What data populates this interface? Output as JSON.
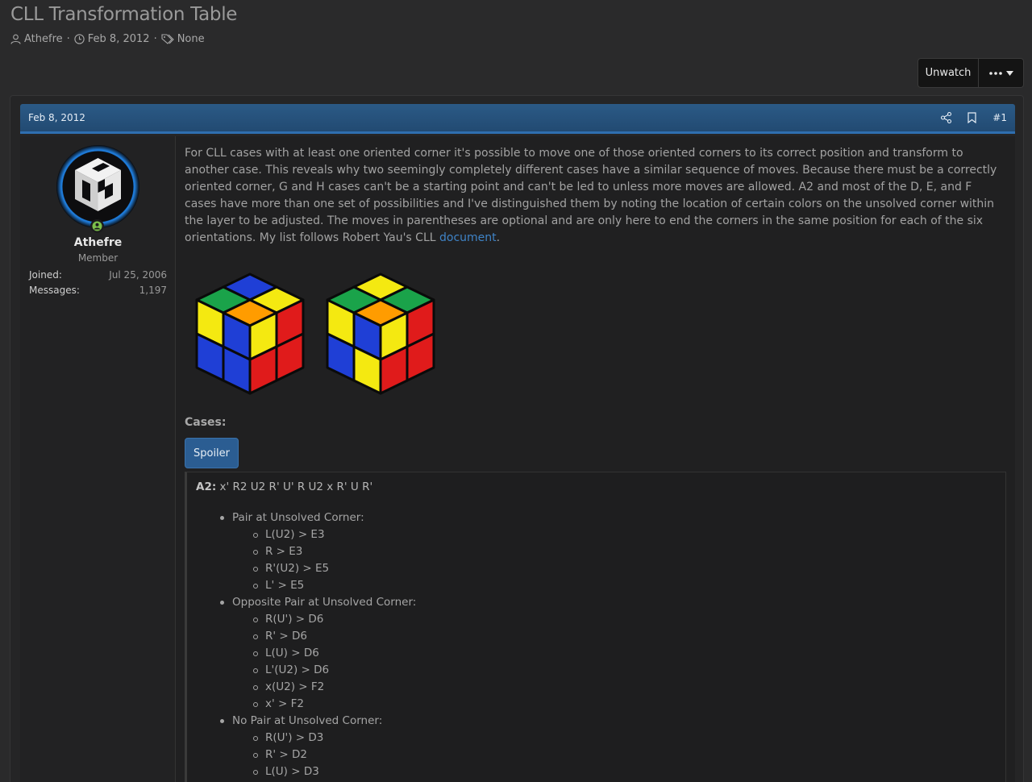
{
  "thread": {
    "title": "CLL Transformation Table",
    "author": "Athefre",
    "date": "Feb 8, 2012",
    "tags": "None"
  },
  "actions": {
    "unwatch_label": "Unwatch"
  },
  "post": {
    "date": "Feb 8, 2012",
    "number": "#1",
    "user": {
      "name": "Athefre",
      "title": "Member",
      "joined_label": "Joined:",
      "joined_value": "Jul 25, 2006",
      "messages_label": "Messages:",
      "messages_value": "1,197"
    },
    "body_text": "For CLL cases with at least one oriented corner it's possible to move one of those oriented corners to its correct position and transform to another case. This reveals why two seemingly completely different cases have a similar sequence of moves. Because there must be a correctly oriented corner, G and H cases can't be a starting point and can't be led to unless more moves are allowed. A2 and most of the D, E, and F cases have more than one set of possibilities and I've distinguished them by noting the location of certain colors on the unsolved corner within the layer to be adjusted. The moves in parentheses are optional and are only here to end the corners in the same position for each of the six orientations. My list follows Robert Yau's CLL",
    "link_text": "document",
    "link_suffix": ".",
    "cases_label": "Cases:",
    "spoiler_label": "Spoiler",
    "formula_case": "A2:",
    "formula_moves": "x' R2 U2 R' U' R U2 x R' U R'",
    "groups": [
      {
        "label": "Pair at Unsolved Corner:",
        "items": [
          "L(U2) > E3",
          "R > E3",
          "R'(U2) > E5",
          "L' > E5"
        ]
      },
      {
        "label": "Opposite Pair at Unsolved Corner:",
        "items": [
          "R(U') > D6",
          "R' > D6",
          "L(U) > D6",
          "L'(U2) > D6",
          "x(U2) > F2",
          "x' > F2"
        ]
      },
      {
        "label": "No Pair at Unsolved Corner:",
        "items": [
          "R(U') > D3",
          "R' > D2",
          "L(U) > D3"
        ]
      }
    ]
  },
  "colors": {
    "header_blue": "#2b5a86",
    "link": "#3f83c6",
    "online": "#7cc04b"
  },
  "icons": [
    "user-icon",
    "clock-icon",
    "tag-icon",
    "share-icon",
    "bookmark-icon",
    "ellipsis-icon",
    "caret-down-icon",
    "online-status-icon"
  ]
}
